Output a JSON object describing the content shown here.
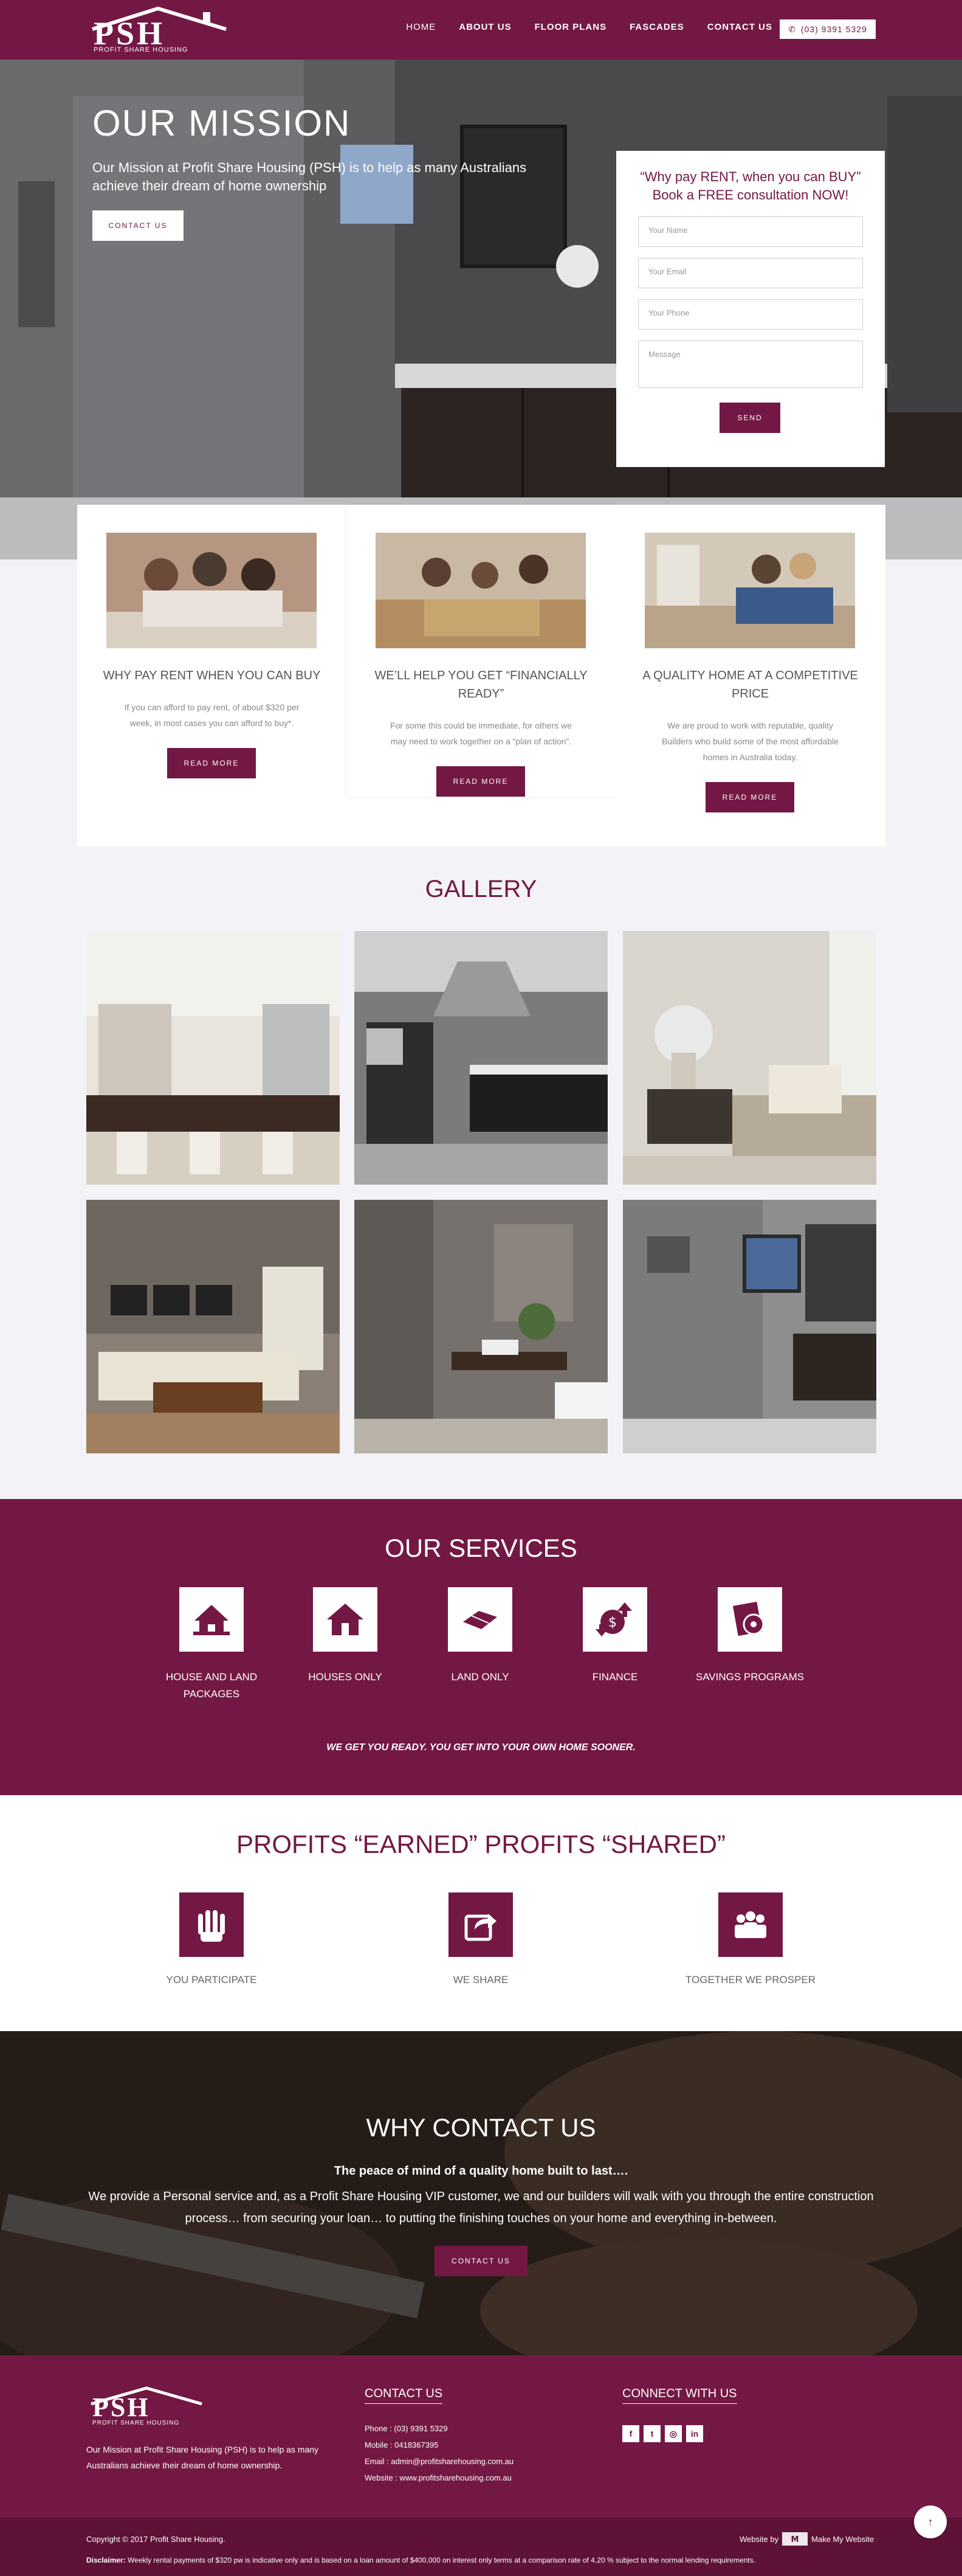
{
  "brand": {
    "name": "PSH",
    "tagline": "PROFIT SHARE HOUSING",
    "accent_color": "#731844"
  },
  "nav": {
    "items": [
      {
        "label": "HOME"
      },
      {
        "label": "ABOUT US"
      },
      {
        "label": "FLOOR PLANS"
      },
      {
        "label": "FASCADES"
      },
      {
        "label": "CONTACT US"
      }
    ],
    "phone": "(03) 9391 5329",
    "phone_icon": "phone-icon"
  },
  "hero": {
    "title": "OUR MISSION",
    "text": "Our Mission at Profit Share Housing (PSH) is to help as many Australians achieve their dream of home ownership",
    "button": "CONTACT US"
  },
  "form": {
    "heading_line1": "“Why pay RENT, when you can BUY”",
    "heading_line2": "Book a FREE consultation NOW!",
    "name_placeholder": "Your Name",
    "email_placeholder": "Your Email",
    "phone_placeholder": "Your Phone",
    "message_placeholder": "Message",
    "send": "SEND"
  },
  "features": [
    {
      "title": "WHY PAY RENT WHEN YOU CAN BUY",
      "text": "If you can afford to pay rent, of about $320 per week, in most cases you can afford to buy*.",
      "button": "READ MORE"
    },
    {
      "title": "WE’LL HELP YOU GET “FINANCIALLY READY”",
      "text": "For some this could be immediate, for others we may need to work together on a “plan of action”.",
      "button": "READ MORE"
    },
    {
      "title": "A QUALITY HOME AT A COMPETITIVE PRICE",
      "text": "We are proud to work with reputable, quality Builders who build some of the most affordable homes in Australia today.",
      "button": "READ MORE"
    }
  ],
  "gallery": {
    "title": "GALLERY"
  },
  "services": {
    "title": "OUR SERVICES",
    "items": [
      {
        "label": "HOUSE AND LAND PACKAGES",
        "icon": "house-and-land-icon"
      },
      {
        "label": "HOUSES ONLY",
        "icon": "house-icon"
      },
      {
        "label": "LAND ONLY",
        "icon": "land-icon"
      },
      {
        "label": "FINANCE",
        "icon": "finance-icon"
      },
      {
        "label": "SAVINGS PROGRAMS",
        "icon": "savings-icon"
      }
    ],
    "tagline": "WE GET YOU READY. YOU GET INTO YOUR OWN HOME SOONER."
  },
  "profits": {
    "title": "PROFITS “EARNED” PROFITS “SHARED”",
    "items": [
      {
        "label": "YOU PARTICIPATE",
        "icon": "raised-hands-icon"
      },
      {
        "label": "WE SHARE",
        "icon": "share-icon"
      },
      {
        "label": "TOGETHER WE PROSPER",
        "icon": "group-icon"
      }
    ]
  },
  "why": {
    "title": "WHY CONTACT US",
    "bold": "The peace of mind of a quality home built to last….",
    "text": "We provide a Personal service and, as a Profit Share Housing VIP customer, we and our builders will walk with you through the entire construction process… from securing your loan… to putting the finishing touches on your home and everything in-between.",
    "button": "CONTACT US"
  },
  "footer": {
    "about": "Our Mission at Profit Share Housing (PSH) is to help as many Australians achieve their dream of home ownership.",
    "contact_title": "CONTACT US",
    "phone": "Phone : (03) 9391 5329",
    "mobile": "Mobile : 0418367395",
    "email": "Email : admin@profitsharehousing.com.au",
    "website": "Website : www.profitsharehousing.com.au",
    "connect_title": "CONNECT WITH US",
    "social": [
      {
        "label": "f",
        "icon": "facebook-icon"
      },
      {
        "label": "t",
        "icon": "twitter-icon"
      },
      {
        "label": "◎",
        "icon": "instagram-icon"
      },
      {
        "label": "in",
        "icon": "linkedin-icon"
      }
    ],
    "copyright": "Copyright © 2017 Profit Share Housing.",
    "website_by": "Website by",
    "maker": "Make My Website",
    "disclaimer_label": "Disclaimer:",
    "disclaimer": "Weekly rental payments of $320 pw is indicative only and is based on a loan amount of $400,000 on interest only terms at a comparison rate of 4.20 % subject to the normal lending requirements.",
    "scroll_top": "↑"
  }
}
